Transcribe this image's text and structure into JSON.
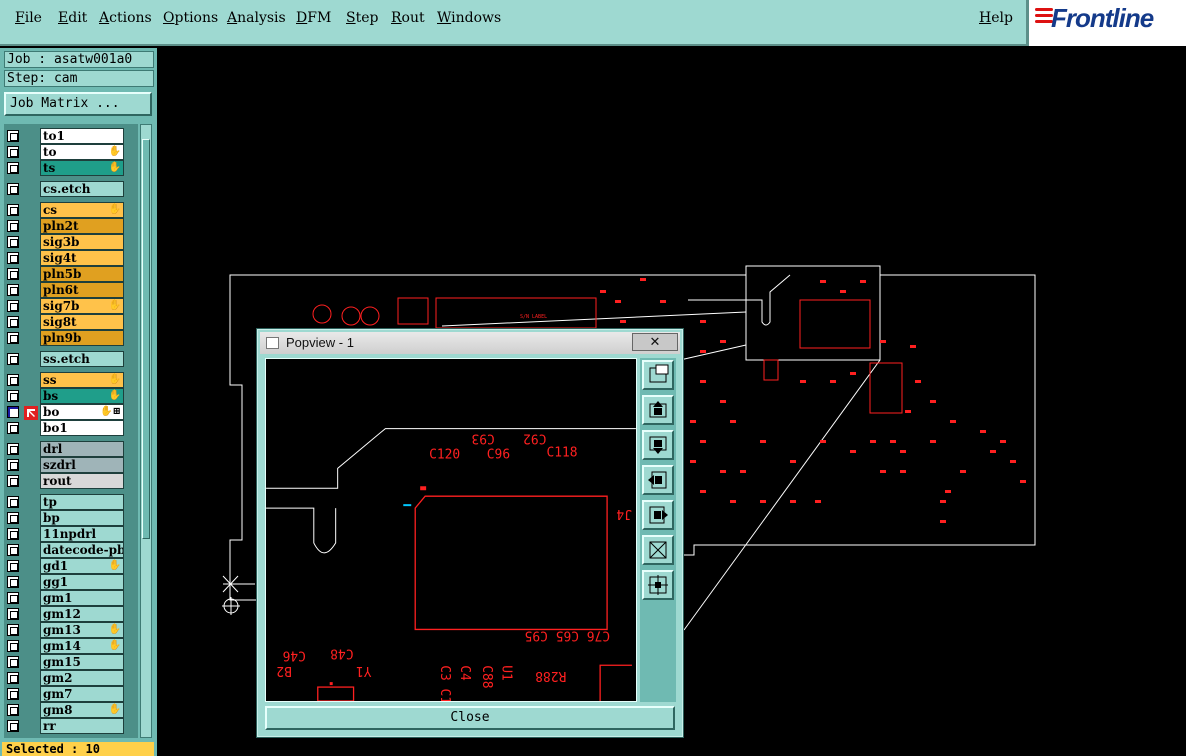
{
  "menu": {
    "items": [
      "File",
      "Edit",
      "Actions",
      "Options",
      "Analysis",
      "DFM",
      "Step",
      "Rout",
      "Windows"
    ],
    "help": "Help",
    "logo": "Frontline"
  },
  "panel": {
    "job": "Job : asatw001a0",
    "step": "Step: cam",
    "job_matrix": "Job Matrix ...",
    "selected": "Selected : 10"
  },
  "layers": [
    {
      "name": "to1",
      "color": "#ffffff",
      "flag": ""
    },
    {
      "name": "to",
      "color": "#ffffff",
      "flag": "✋"
    },
    {
      "name": "ts",
      "color": "#1f9e8a",
      "flag": "✋"
    },
    {
      "name": "cs.etch",
      "color": "#9ed9d1",
      "flag": ""
    },
    {
      "name": "cs",
      "color": "#ffc24a",
      "flag": "✋"
    },
    {
      "name": "pln2t",
      "color": "#e0a020",
      "flag": ""
    },
    {
      "name": "sig3b",
      "color": "#ffc24a",
      "flag": ""
    },
    {
      "name": "sig4t",
      "color": "#ffc24a",
      "flag": ""
    },
    {
      "name": "pln5b",
      "color": "#e0a020",
      "flag": ""
    },
    {
      "name": "pln6t",
      "color": "#e0a020",
      "flag": ""
    },
    {
      "name": "sig7b",
      "color": "#ffc24a",
      "flag": "✋"
    },
    {
      "name": "sig8t",
      "color": "#ffc24a",
      "flag": ""
    },
    {
      "name": "pln9b",
      "color": "#e0a020",
      "flag": ""
    },
    {
      "name": "ss.etch",
      "color": "#9ed9d1",
      "flag": ""
    },
    {
      "name": "ss",
      "color": "#ffc24a",
      "flag": "✋"
    },
    {
      "name": "bs",
      "color": "#1f9e8a",
      "flag": "✋"
    },
    {
      "name": "bo",
      "color": "#ffffff",
      "flag": "✋⊞"
    },
    {
      "name": "bo1",
      "color": "#ffffff",
      "flag": ""
    },
    {
      "name": "drl",
      "color": "#9fb4b8",
      "flag": ""
    },
    {
      "name": "szdrl",
      "color": "#9fb4b8",
      "flag": ""
    },
    {
      "name": "rout",
      "color": "#d8d8d8",
      "flag": ""
    },
    {
      "name": "tp",
      "color": "#9ed9d1",
      "flag": ""
    },
    {
      "name": "bp",
      "color": "#9ed9d1",
      "flag": ""
    },
    {
      "name": "11npdrl",
      "color": "#9ed9d1",
      "flag": ""
    },
    {
      "name": "datecode-pbe",
      "color": "#9ed9d1",
      "flag": ""
    },
    {
      "name": "gd1",
      "color": "#9ed9d1",
      "flag": "✋"
    },
    {
      "name": "gg1",
      "color": "#9ed9d1",
      "flag": ""
    },
    {
      "name": "gm1",
      "color": "#9ed9d1",
      "flag": ""
    },
    {
      "name": "gm12",
      "color": "#9ed9d1",
      "flag": ""
    },
    {
      "name": "gm13",
      "color": "#9ed9d1",
      "flag": "✋"
    },
    {
      "name": "gm14",
      "color": "#9ed9d1",
      "flag": "✋"
    },
    {
      "name": "gm15",
      "color": "#9ed9d1",
      "flag": ""
    },
    {
      "name": "gm2",
      "color": "#9ed9d1",
      "flag": ""
    },
    {
      "name": "gm7",
      "color": "#9ed9d1",
      "flag": ""
    },
    {
      "name": "gm8",
      "color": "#9ed9d1",
      "flag": "✋"
    },
    {
      "name": "rr",
      "color": "#9ed9d1",
      "flag": ""
    }
  ],
  "popview": {
    "title": "Popview - 1",
    "close_x": "✕",
    "close_label": "Close",
    "silk": [
      "C93",
      "C92",
      "C120",
      "C96",
      "C118",
      "C76 C65 C95",
      "C48",
      "C46",
      "Y1",
      "B2",
      "R288",
      "C3 C1",
      "C4",
      "C88",
      "U1",
      "J4"
    ]
  },
  "board_labels": [
    "S/N LABEL"
  ]
}
